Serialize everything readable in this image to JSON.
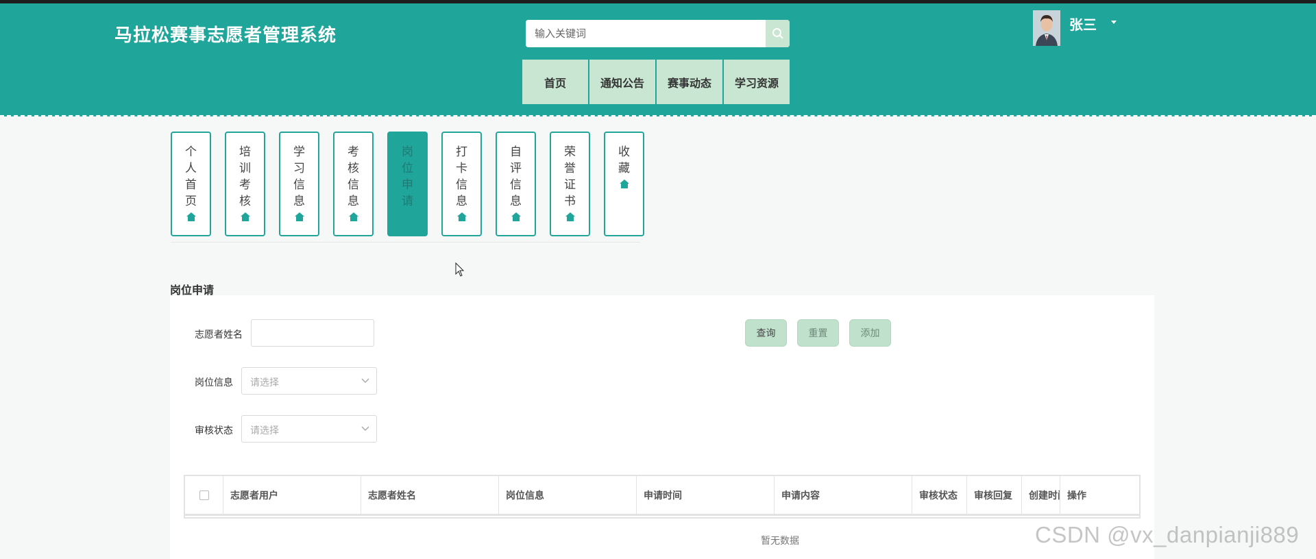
{
  "header": {
    "title": "马拉松赛事志愿者管理系统",
    "search_placeholder": "输入关键词",
    "nav": [
      "首页",
      "通知公告",
      "赛事动态",
      "学习资源"
    ],
    "username": "张三"
  },
  "side_menu": [
    {
      "label": "个人首页",
      "active": false
    },
    {
      "label": "培训考核",
      "active": false
    },
    {
      "label": "学习信息",
      "active": false
    },
    {
      "label": "考核信息",
      "active": false
    },
    {
      "label": "岗位申请",
      "active": true
    },
    {
      "label": "打卡信息",
      "active": false
    },
    {
      "label": "自评信息",
      "active": false
    },
    {
      "label": "荣誉证书",
      "active": false
    },
    {
      "label": "收藏",
      "active": false
    }
  ],
  "section": {
    "title": "岗位申请",
    "filters": {
      "name_label": "志愿者姓名",
      "post_label": "岗位信息",
      "post_placeholder": "请选择",
      "status_label": "审核状态",
      "status_placeholder": "请选择"
    },
    "buttons": {
      "query": "查询",
      "reset": "重置",
      "add": "添加"
    }
  },
  "table": {
    "columns": [
      "志愿者用户",
      "志愿者姓名",
      "岗位信息",
      "申请时间",
      "申请内容",
      "审核状态",
      "审核回复",
      "创建时间",
      "操作"
    ],
    "empty_text": "暂无数据"
  },
  "watermark": "CSDN @vx_danpianji889",
  "colors": {
    "primary": "#1fa59a",
    "nav_bg": "#c8e6d2",
    "button_bg": "#c0e1cc"
  }
}
